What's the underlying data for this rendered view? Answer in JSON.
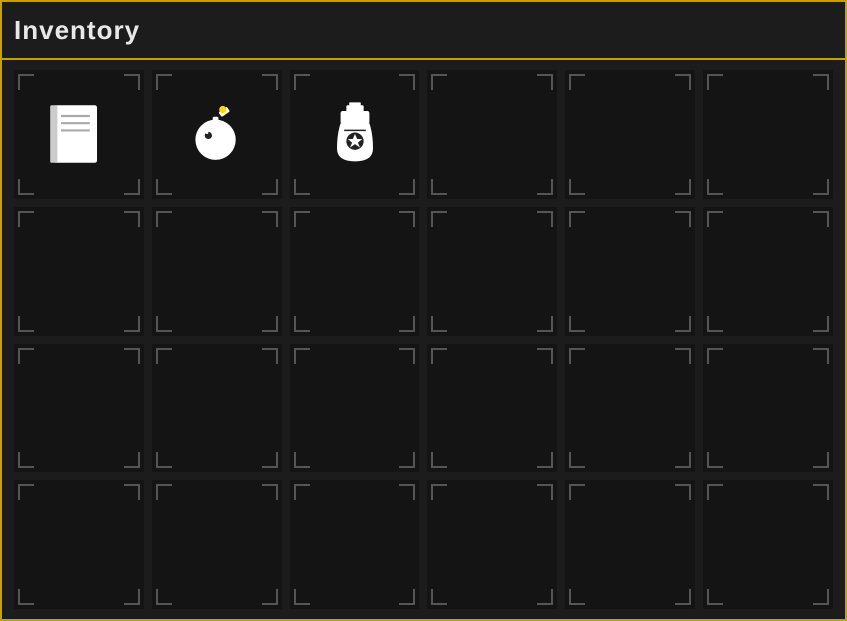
{
  "header": {
    "title": "Inventory"
  },
  "grid": {
    "rows": 4,
    "cols": 6,
    "total": 24,
    "items": [
      {
        "id": 0,
        "icon": "book",
        "row": 0,
        "col": 0
      },
      {
        "id": 1,
        "icon": "bomb",
        "row": 0,
        "col": 1
      },
      {
        "id": 2,
        "icon": "poison",
        "row": 0,
        "col": 2
      },
      {
        "id": 3,
        "icon": "empty",
        "row": 0,
        "col": 3
      },
      {
        "id": 4,
        "icon": "empty",
        "row": 0,
        "col": 4
      },
      {
        "id": 5,
        "icon": "empty",
        "row": 0,
        "col": 5
      },
      {
        "id": 6,
        "icon": "empty",
        "row": 1,
        "col": 0
      },
      {
        "id": 7,
        "icon": "empty",
        "row": 1,
        "col": 1
      },
      {
        "id": 8,
        "icon": "empty",
        "row": 1,
        "col": 2
      },
      {
        "id": 9,
        "icon": "empty",
        "row": 1,
        "col": 3
      },
      {
        "id": 10,
        "icon": "empty",
        "row": 1,
        "col": 4
      },
      {
        "id": 11,
        "icon": "empty",
        "row": 1,
        "col": 5
      },
      {
        "id": 12,
        "icon": "empty",
        "row": 2,
        "col": 0
      },
      {
        "id": 13,
        "icon": "empty",
        "row": 2,
        "col": 1
      },
      {
        "id": 14,
        "icon": "empty",
        "row": 2,
        "col": 2
      },
      {
        "id": 15,
        "icon": "empty",
        "row": 2,
        "col": 3
      },
      {
        "id": 16,
        "icon": "empty",
        "row": 2,
        "col": 4
      },
      {
        "id": 17,
        "icon": "empty",
        "row": 2,
        "col": 5
      },
      {
        "id": 18,
        "icon": "empty",
        "row": 3,
        "col": 0
      },
      {
        "id": 19,
        "icon": "empty",
        "row": 3,
        "col": 1
      },
      {
        "id": 20,
        "icon": "empty",
        "row": 3,
        "col": 2
      },
      {
        "id": 21,
        "icon": "empty",
        "row": 3,
        "col": 3
      },
      {
        "id": 22,
        "icon": "empty",
        "row": 3,
        "col": 4
      },
      {
        "id": 23,
        "icon": "empty",
        "row": 3,
        "col": 5
      }
    ]
  }
}
